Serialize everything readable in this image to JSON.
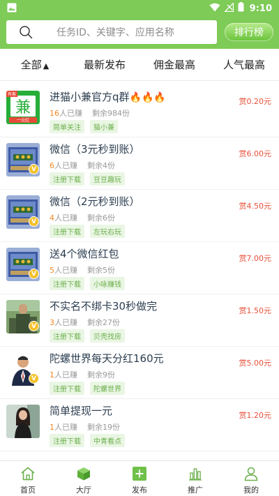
{
  "status_bar": {
    "time": "9:10"
  },
  "search": {
    "placeholder": "任务ID、关键字、应用名称",
    "rank_label": "排行榜"
  },
  "filters": [
    {
      "label": "全部",
      "arrow": "▲"
    },
    {
      "label": "最新发布"
    },
    {
      "label": "佣金最高"
    },
    {
      "label": "人气最高"
    }
  ],
  "tasks": [
    {
      "title": "进猫小兼官方q群",
      "fires": "🔥🔥🔥",
      "earned": "16",
      "earned_suffix": "人已赚",
      "remaining": "剩余984份",
      "tags": [
        "简单关注",
        "猫小兼"
      ],
      "reward": "赏0.20元",
      "thumb": "logo"
    },
    {
      "title": "微信（3元秒到账）",
      "fires": "",
      "earned": "6",
      "earned_suffix": "人已赚",
      "remaining": "剩余4份",
      "tags": [
        "注册下载",
        "豆豆趣玩"
      ],
      "reward": "赏6.00元",
      "thumb": "game"
    },
    {
      "title": "微信（2元秒到账）",
      "fires": "",
      "earned": "4",
      "earned_suffix": "人已赚",
      "remaining": "剩余6份",
      "tags": [
        "注册下载",
        "左玩右玩"
      ],
      "reward": "赏4.50元",
      "thumb": "game"
    },
    {
      "title": "送4个微信红包",
      "fires": "",
      "earned": "5",
      "earned_suffix": "人已赚",
      "remaining": "剩余5份",
      "tags": [
        "注册下载",
        "小咏赚钱"
      ],
      "reward": "赏7.00元",
      "thumb": "game"
    },
    {
      "title": "不实名不绑卡30秒做完",
      "fires": "",
      "earned": "3",
      "earned_suffix": "人已赚",
      "remaining": "剩余27份",
      "tags": [
        "注册下载",
        "贝壳找房"
      ],
      "reward": "赏1.50元",
      "thumb": "soldier"
    },
    {
      "title": "陀螺世界每天分红160元",
      "fires": "",
      "earned": "1",
      "earned_suffix": "人已赚",
      "remaining": "剩余9份",
      "tags": [
        "注册下载",
        "陀螺世界"
      ],
      "reward": "赏5.00元",
      "thumb": "suit"
    },
    {
      "title": "简单提现一元",
      "fires": "",
      "earned": "1",
      "earned_suffix": "人已赚",
      "remaining": "剩余19份",
      "tags": [
        "注册下载",
        "中青看点"
      ],
      "reward": "赏1.20元",
      "thumb": "woman"
    }
  ],
  "logo_thumb": {
    "badge": "有客",
    "char": "兼",
    "caption": "一元红"
  },
  "badge_letter": "V",
  "nav": [
    {
      "label": "首页",
      "icon": "home-icon"
    },
    {
      "label": "大厅",
      "icon": "cube-icon"
    },
    {
      "label": "发布",
      "icon": "plus-square-icon"
    },
    {
      "label": "推广",
      "icon": "bar-chart-icon"
    },
    {
      "label": "我的",
      "icon": "user-icon"
    }
  ],
  "colors": {
    "brand_green": "#7ecb57",
    "reward_red": "#e8503a",
    "tag_green": "#6aaf4a",
    "stat_orange": "#f08a24"
  }
}
